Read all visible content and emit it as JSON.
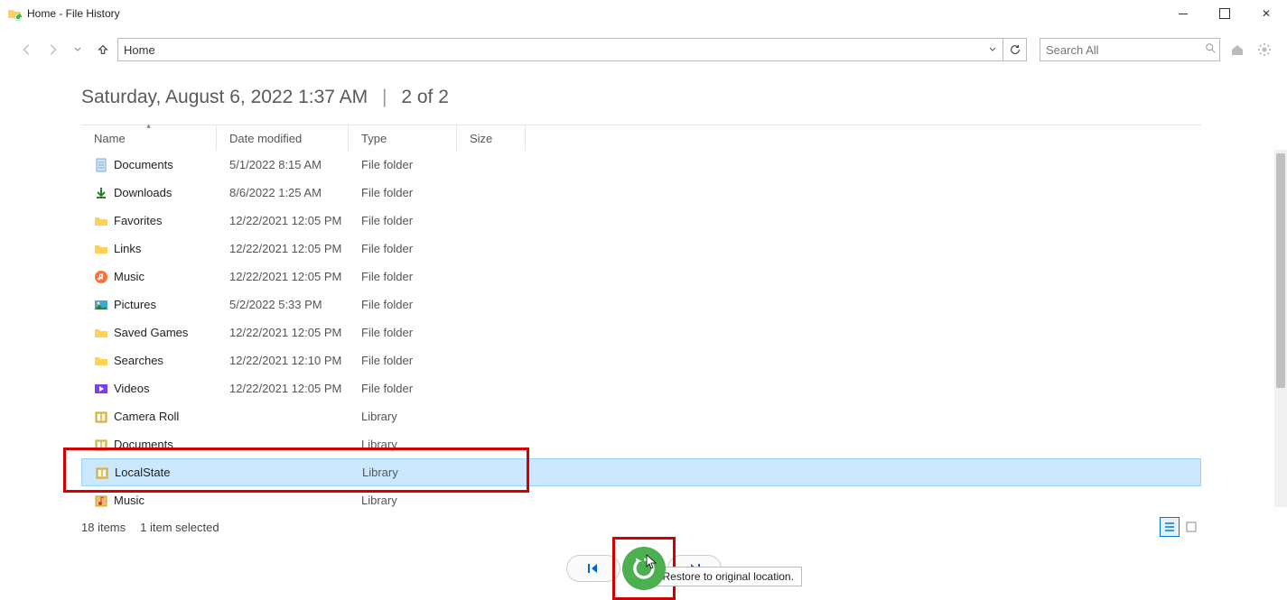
{
  "window": {
    "title": "Home - File History"
  },
  "nav": {
    "location": "Home",
    "search_placeholder": "Search All"
  },
  "header": {
    "timestamp": "Saturday, August 6, 2022 1:37 AM",
    "separator": "|",
    "range": "2 of 2"
  },
  "columns": {
    "name": "Name",
    "date": "Date modified",
    "type": "Type",
    "size": "Size"
  },
  "rows": [
    {
      "icon": "document",
      "name": "Documents",
      "date": "5/1/2022 8:15 AM",
      "type": "File folder",
      "selected": false
    },
    {
      "icon": "download",
      "name": "Downloads",
      "date": "8/6/2022 1:25 AM",
      "type": "File folder",
      "selected": false
    },
    {
      "icon": "folder",
      "name": "Favorites",
      "date": "12/22/2021 12:05 PM",
      "type": "File folder",
      "selected": false
    },
    {
      "icon": "folder",
      "name": "Links",
      "date": "12/22/2021 12:05 PM",
      "type": "File folder",
      "selected": false
    },
    {
      "icon": "music",
      "name": "Music",
      "date": "12/22/2021 12:05 PM",
      "type": "File folder",
      "selected": false
    },
    {
      "icon": "pictures",
      "name": "Pictures",
      "date": "5/2/2022 5:33 PM",
      "type": "File folder",
      "selected": false
    },
    {
      "icon": "folder",
      "name": "Saved Games",
      "date": "12/22/2021 12:05 PM",
      "type": "File folder",
      "selected": false
    },
    {
      "icon": "folder",
      "name": "Searches",
      "date": "12/22/2021 12:10 PM",
      "type": "File folder",
      "selected": false
    },
    {
      "icon": "video",
      "name": "Videos",
      "date": "12/22/2021 12:05 PM",
      "type": "File folder",
      "selected": false
    },
    {
      "icon": "library",
      "name": "Camera Roll",
      "date": "",
      "type": "Library",
      "selected": false
    },
    {
      "icon": "library",
      "name": "Documents",
      "date": "",
      "type": "Library",
      "selected": false
    },
    {
      "icon": "library",
      "name": "LocalState",
      "date": "",
      "type": "Library",
      "selected": true
    },
    {
      "icon": "musiclib",
      "name": "Music",
      "date": "",
      "type": "Library",
      "selected": false
    }
  ],
  "status": {
    "count": "18 items",
    "selected": "1 item selected"
  },
  "tooltip": "Restore to original location."
}
